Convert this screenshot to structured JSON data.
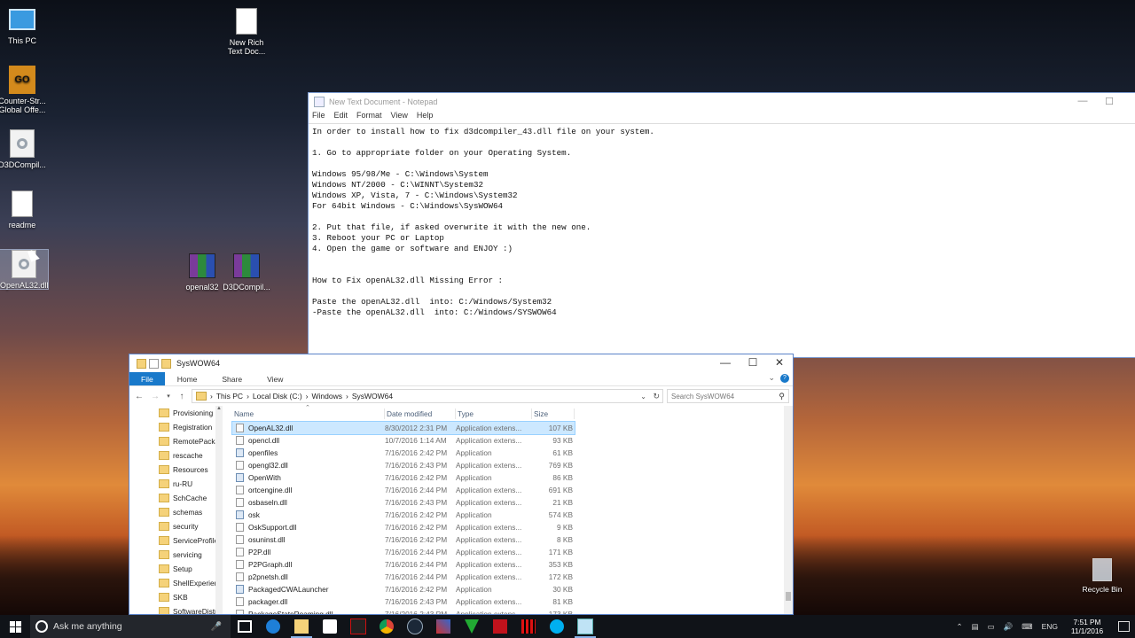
{
  "desktop": {
    "icons": [
      {
        "label": "This PC",
        "icon": "computer-icon"
      },
      {
        "label": "Counter-Str... Global Offe...",
        "icon": "csgo-icon",
        "badge": "GO"
      },
      {
        "label": "D3DCompil...",
        "icon": "dll-file-icon"
      },
      {
        "label": "readme",
        "icon": "text-file-icon"
      },
      {
        "label": "OpenAL32.dll",
        "icon": "dll-file-icon"
      },
      {
        "label": "New Rich Text Doc...",
        "icon": "rtf-file-icon"
      },
      {
        "label": "openal32",
        "icon": "winrar-archive-icon"
      },
      {
        "label": "D3DCompil...",
        "icon": "winrar-archive-icon"
      }
    ],
    "recycle_bin": "Recycle Bin"
  },
  "notepad": {
    "title": "New Text Document - Notepad",
    "menu": [
      "File",
      "Edit",
      "Format",
      "View",
      "Help"
    ],
    "lines": [
      "In order to install how to fix d3dcompiler_43.dll file on your system.",
      "",
      "1. Go to appropriate folder on your Operating System.",
      "",
      "Windows 95/98/Me - C:\\Windows\\System",
      "Windows NT/2000 - C:\\WINNT\\System32",
      "Windows XP, Vista, 7 - C:\\Windows\\System32",
      "For 64bit Windows - C:\\Windows\\SysWOW64",
      "",
      "2. Put that file, if asked overwrite it with the new one.",
      "3. Reboot your PC or Laptop",
      "4. Open the game or software and ENJOY :)",
      "",
      "",
      "How to Fix openAL32.dll Missing Error :",
      "",
      "Paste the openAL32.dll  into: C:/Windows/System32",
      "-Paste the openAL32.dll  into: C:/Windows/SYSWOW64"
    ]
  },
  "explorer": {
    "title": "SysWOW64",
    "ribbon_tabs": [
      "File",
      "Home",
      "Share",
      "View"
    ],
    "breadcrumb": [
      "This PC",
      "Local Disk (C:)",
      "Windows",
      "SysWOW64"
    ],
    "search_placeholder": "Search SysWOW64",
    "tree": [
      "Provisioning",
      "Registration",
      "RemotePacka",
      "rescache",
      "Resources",
      "ru-RU",
      "SchCache",
      "schemas",
      "security",
      "ServiceProfile",
      "servicing",
      "Setup",
      "ShellExperien",
      "SKB",
      "SoftwareDistr"
    ],
    "columns": [
      "Name",
      "Date modified",
      "Type",
      "Size"
    ],
    "files": [
      {
        "name": "OpenAL32.dll",
        "date": "8/30/2012 2:31 PM",
        "type": "Application extens...",
        "size": "107 KB",
        "kind": "dll",
        "selected": true
      },
      {
        "name": "opencl.dll",
        "date": "10/7/2016 1:14 AM",
        "type": "Application extens...",
        "size": "93 KB",
        "kind": "dll"
      },
      {
        "name": "openfiles",
        "date": "7/16/2016 2:42 PM",
        "type": "Application",
        "size": "61 KB",
        "kind": "app"
      },
      {
        "name": "opengl32.dll",
        "date": "7/16/2016 2:43 PM",
        "type": "Application extens...",
        "size": "769 KB",
        "kind": "dll"
      },
      {
        "name": "OpenWith",
        "date": "7/16/2016 2:42 PM",
        "type": "Application",
        "size": "86 KB",
        "kind": "app"
      },
      {
        "name": "ortcengine.dll",
        "date": "7/16/2016 2:44 PM",
        "type": "Application extens...",
        "size": "691 KB",
        "kind": "dll"
      },
      {
        "name": "osbaseln.dll",
        "date": "7/16/2016 2:43 PM",
        "type": "Application extens...",
        "size": "21 KB",
        "kind": "dll"
      },
      {
        "name": "osk",
        "date": "7/16/2016 2:42 PM",
        "type": "Application",
        "size": "574 KB",
        "kind": "app"
      },
      {
        "name": "OskSupport.dll",
        "date": "7/16/2016 2:42 PM",
        "type": "Application extens...",
        "size": "9 KB",
        "kind": "dll"
      },
      {
        "name": "osuninst.dll",
        "date": "7/16/2016 2:42 PM",
        "type": "Application extens...",
        "size": "8 KB",
        "kind": "dll"
      },
      {
        "name": "P2P.dll",
        "date": "7/16/2016 2:44 PM",
        "type": "Application extens...",
        "size": "171 KB",
        "kind": "dll"
      },
      {
        "name": "P2PGraph.dll",
        "date": "7/16/2016 2:44 PM",
        "type": "Application extens...",
        "size": "353 KB",
        "kind": "dll"
      },
      {
        "name": "p2pnetsh.dll",
        "date": "7/16/2016 2:44 PM",
        "type": "Application extens...",
        "size": "172 KB",
        "kind": "dll"
      },
      {
        "name": "PackagedCWALauncher",
        "date": "7/16/2016 2:42 PM",
        "type": "Application",
        "size": "30 KB",
        "kind": "app"
      },
      {
        "name": "packager.dll",
        "date": "7/16/2016 2:43 PM",
        "type": "Application extens...",
        "size": "81 KB",
        "kind": "dll"
      },
      {
        "name": "PackageStateRoaming.dll",
        "date": "7/16/2016 2:43 PM",
        "type": "Application extens...",
        "size": "173 KB",
        "kind": "dll"
      }
    ]
  },
  "taskbar": {
    "search_placeholder": "Ask me anything",
    "language": "ENG",
    "time": "7:51 PM",
    "date": "11/1/2016"
  },
  "colors": {
    "accent": "#1979ca",
    "selection": "#cce8ff"
  }
}
